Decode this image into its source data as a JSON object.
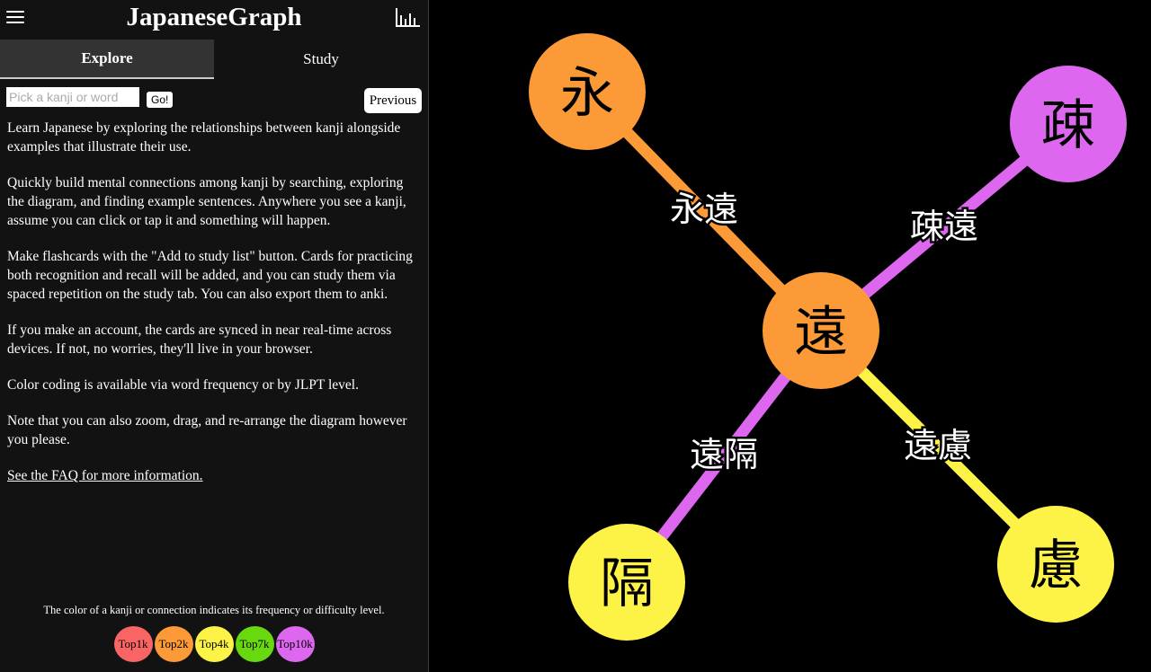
{
  "header": {
    "title": "JapaneseGraph",
    "menu_icon": "hamburger-menu-icon",
    "stats_icon": "bar-chart-icon"
  },
  "tabs": [
    {
      "label": "Explore",
      "active": true
    },
    {
      "label": "Study",
      "active": false
    }
  ],
  "search": {
    "placeholder": "Pick a kanji or word",
    "value": "",
    "go_label": "Go!",
    "previous_label": "Previous"
  },
  "intro": {
    "paragraphs": [
      "Learn Japanese by exploring the relationships between kanji alongside examples that illustrate their use.",
      "Quickly build mental connections among kanji by searching, exploring the diagram, and finding example sentences. Anywhere you see a kanji, assume you can click or tap it and something will happen.",
      "Make flashcards with the \"Add to study list\" button. Cards for practicing both recognition and recall will be added, and you can study them via spaced repetition on the study tab. You can also export them to anki.",
      "If you make an account, the cards are synced in near real-time across devices. If not, no worries, they'll live in your browser.",
      "Color coding is available via word frequency or by JLPT level.",
      "Note that you can also zoom, drag, and re-arrange the diagram however you please."
    ],
    "faq_link": "See the FAQ for more information."
  },
  "legend": {
    "caption": "The color of a kanji or connection indicates its frequency or difficulty level.",
    "levels": [
      {
        "label": "Top1k",
        "color": "#f96565"
      },
      {
        "label": "Top2k",
        "color": "#fb9a36"
      },
      {
        "label": "Top4k",
        "color": "#fdf347"
      },
      {
        "label": "Top7k",
        "color": "#68d90e"
      },
      {
        "label": "Top10k",
        "color": "#dd67ef"
      }
    ]
  },
  "graph": {
    "nodes": [
      {
        "id": "ei",
        "kanji": "永",
        "level": "Top2k",
        "color": "#fb9a36"
      },
      {
        "id": "so",
        "kanji": "疎",
        "level": "Top10k",
        "color": "#dd67ef"
      },
      {
        "id": "en",
        "kanji": "遠",
        "level": "Top2k",
        "color": "#fb9a36",
        "center": true
      },
      {
        "id": "kaku",
        "kanji": "隔",
        "level": "Top4k",
        "color": "#fdf347"
      },
      {
        "id": "ryo",
        "kanji": "慮",
        "level": "Top4k",
        "color": "#fdf347"
      }
    ],
    "edges": [
      {
        "source": "en",
        "target": "ei",
        "word": "永遠",
        "color": "#fb9a36"
      },
      {
        "source": "en",
        "target": "so",
        "word": "疎遠",
        "color": "#dd67ef"
      },
      {
        "source": "en",
        "target": "kaku",
        "word": "遠隔",
        "color": "#dd67ef"
      },
      {
        "source": "en",
        "target": "ryo",
        "word": "遠慮",
        "color": "#fdf347"
      }
    ]
  }
}
